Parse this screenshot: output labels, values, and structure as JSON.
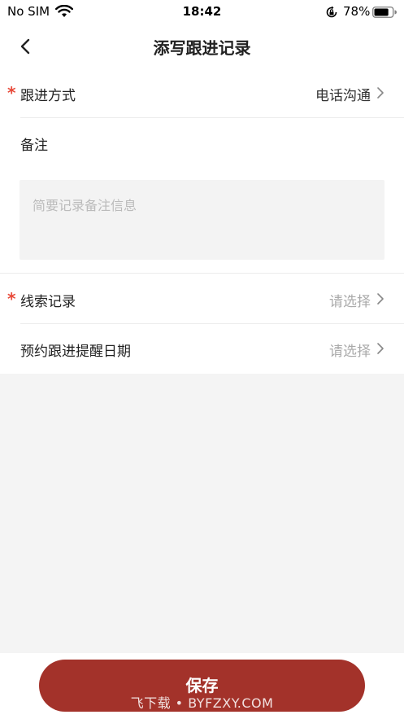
{
  "status_bar": {
    "carrier": "No SIM",
    "time": "18:42",
    "battery_percent": "78%",
    "battery_level": 0.78,
    "icons": [
      "wifi-icon",
      "orientation-lock-icon",
      "battery-icon"
    ]
  },
  "nav": {
    "title": "添写跟进记录",
    "back_icon": "chevron-left-icon"
  },
  "form": {
    "follow_method": {
      "label": "跟进方式",
      "required_mark": "*",
      "value": "电话沟通"
    },
    "notes": {
      "label": "备注",
      "placeholder": "简要记录备注信息",
      "value": ""
    },
    "lead_record": {
      "label": "线索记录",
      "required_mark": "*",
      "value": "请选择"
    },
    "reminder_date": {
      "label": "预约跟进提醒日期",
      "value": "请选择"
    }
  },
  "footer": {
    "save_label": "保存",
    "watermark": "飞下载 • BYFZXY.COM"
  },
  "colors": {
    "accent": "#a3322a",
    "required": "#e84a3a",
    "page_bg": "#f4f4f4"
  }
}
